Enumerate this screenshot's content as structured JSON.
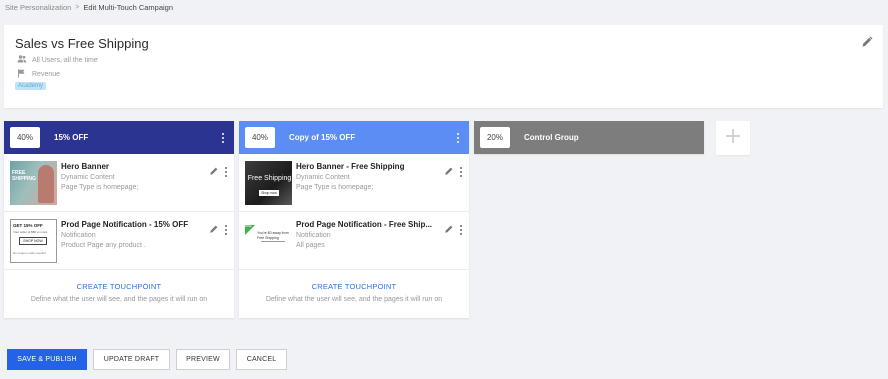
{
  "breadcrumb": {
    "parent": "Site Personalization",
    "separator": ">",
    "current": "Edit Multi-Touch Campaign"
  },
  "campaign": {
    "title": "Sales vs Free Shipping",
    "audience": "All Users, all the time",
    "goal": "Revenue",
    "tag": "Academy"
  },
  "variants": [
    {
      "percent": "40%",
      "name": "15% OFF",
      "color": "#2c3491",
      "touchpoints": [
        {
          "name": "Hero Banner",
          "type": "Dynamic Content",
          "condition": "Page Type is homepage;",
          "thumb_text": "FREE SHIPPING"
        },
        {
          "name": "Prod Page Notification - 15% OFF",
          "type": "Notification",
          "condition": "Product Page any product .",
          "thumb_title": "GET 15% OFF",
          "thumb_line": "Your order of $50 or more",
          "thumb_button": "SHOP NOW",
          "thumb_note": "No coupon code needed"
        }
      ],
      "create_label": "CREATE TOUCHPOINT",
      "create_hint": "Define what the user will see, and the pages it will run on"
    },
    {
      "percent": "40%",
      "name": "Copy of 15% OFF",
      "color": "#5b8df5",
      "touchpoints": [
        {
          "name": "Hero Banner - Free Shipping",
          "type": "Dynamic Content",
          "condition": "Page Type is homepage;",
          "thumb_text": "Free Shipping",
          "thumb_button": "Shop now"
        },
        {
          "name": "Prod Page Notification - Free Ship...",
          "type": "Notification",
          "condition": "All pages",
          "thumb_title": "You're $0 away from Free Shipping",
          "thumb_badge": "FREE"
        }
      ],
      "create_label": "CREATE TOUCHPOINT",
      "create_hint": "Define what the user will see, and the pages it will run on"
    },
    {
      "percent": "20%",
      "name": "Control Group",
      "color": "#7d7d7d"
    }
  ],
  "add_variant_symbol": "+",
  "footer": {
    "save_publish": "SAVE & PUBLISH",
    "update_draft": "UPDATE DRAFT",
    "preview": "PREVIEW",
    "cancel": "CANCEL"
  }
}
